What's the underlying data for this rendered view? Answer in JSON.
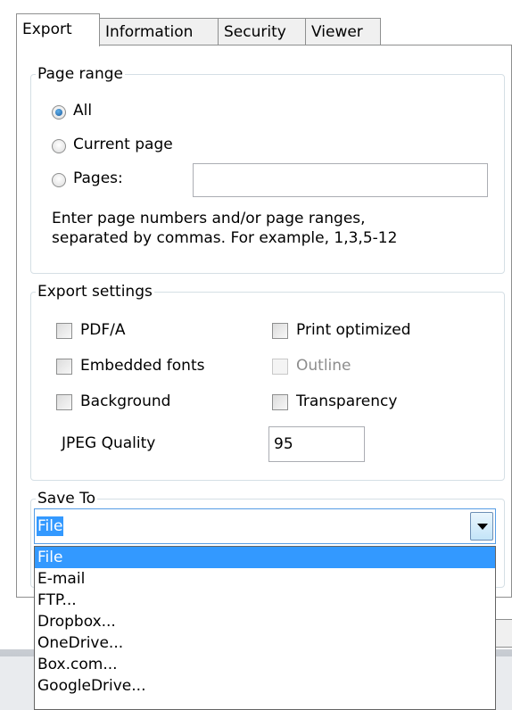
{
  "tabs": [
    "Export",
    "Information",
    "Security",
    "Viewer"
  ],
  "page_range": {
    "legend": "Page range",
    "all_label": "All",
    "current_label": "Current page",
    "pages_label": "Pages:",
    "pages_value": "",
    "selected": "All",
    "hint": "Enter page numbers and/or page ranges,\nseparated by commas. For example, 1,3,5-12"
  },
  "export_settings": {
    "legend": "Export settings",
    "pdfa_label": "PDF/A",
    "print_optimized_label": "Print optimized",
    "embedded_fonts_label": "Embedded fonts",
    "outline_label": "Outline",
    "background_label": "Background",
    "transparency_label": "Transparency",
    "jpeg_quality_label": "JPEG Quality",
    "jpeg_quality_value": "95"
  },
  "save_to": {
    "legend": "Save To",
    "value": "File",
    "options": [
      "File",
      "E-mail",
      "FTP...",
      "Dropbox...",
      "OneDrive...",
      "Box.com...",
      "GoogleDrive..."
    ]
  },
  "colors": {
    "selection": "#3399ff",
    "group_border": "#d5dfe5"
  }
}
